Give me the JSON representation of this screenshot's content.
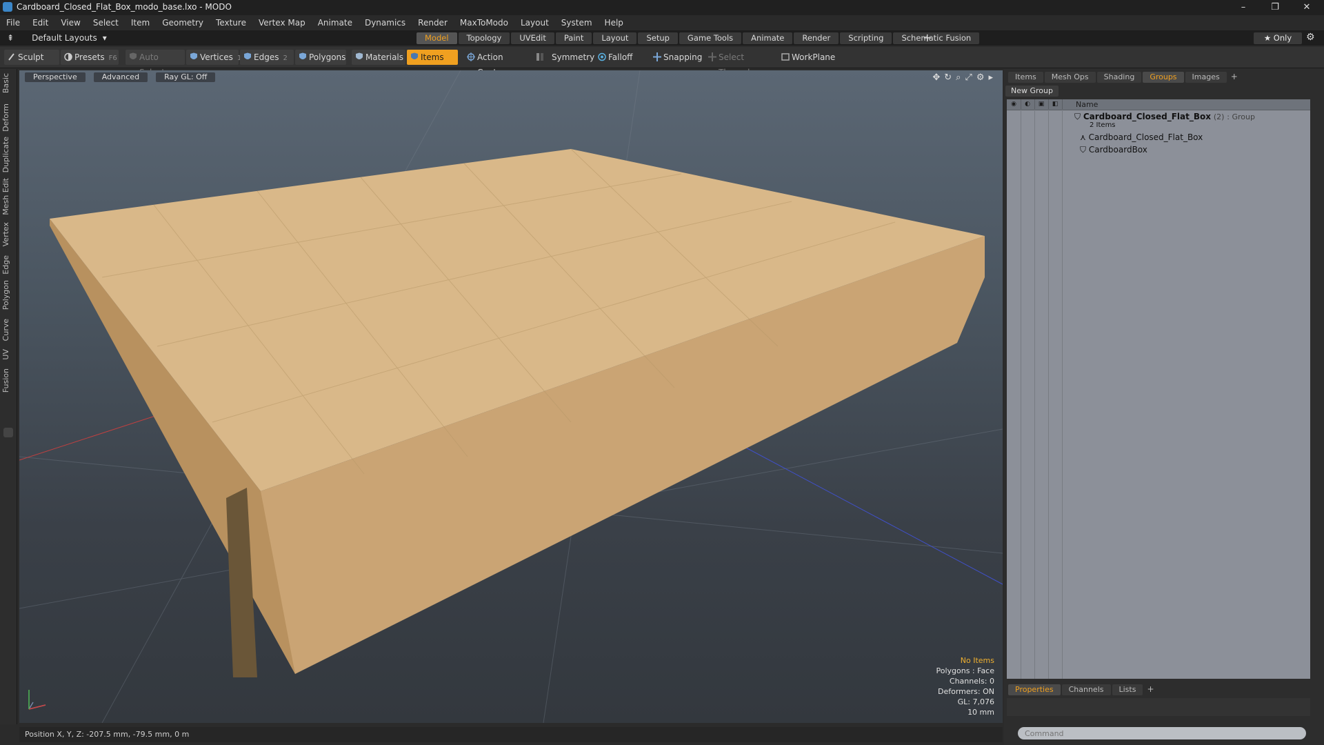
{
  "window": {
    "title": "Cardboard_Closed_Flat_Box_modo_base.lxo - MODO",
    "minimize": "–",
    "maximize": "❐",
    "close": "✕"
  },
  "menu": [
    "File",
    "Edit",
    "View",
    "Select",
    "Item",
    "Geometry",
    "Texture",
    "Vertex Map",
    "Animate",
    "Dynamics",
    "Render",
    "MaxToModo",
    "Layout",
    "System",
    "Help"
  ],
  "layout_bar": {
    "layouts_label": "Default Layouts",
    "tabs": [
      "Model",
      "Topology",
      "UVEdit",
      "Paint",
      "Layout",
      "Setup",
      "Game Tools",
      "Animate",
      "Render",
      "Scripting",
      "Schematic Fusion"
    ],
    "active_tab": "Model",
    "only_label": "★ Only"
  },
  "toolbar": {
    "sculpt": "Sculpt",
    "presets": "Presets",
    "presets_key": "F6",
    "auto_select": "Auto Select",
    "vertices": "Vertices",
    "vertices_num": "1",
    "edges": "Edges",
    "edges_num": "2",
    "polygons": "Polygons",
    "materials": "Materials",
    "items": "Items",
    "action_center": "Action Center",
    "symmetry": "Symmetry",
    "falloff": "Falloff",
    "snapping": "Snapping",
    "select_through": "Select Through",
    "workplane": "WorkPlane"
  },
  "left_tabs": [
    "Basic",
    "Deform",
    "Duplicate",
    "Mesh Edit",
    "Vertex",
    "Edge",
    "Polygon",
    "Curve",
    "UV",
    "Fusion"
  ],
  "viewport": {
    "view_mode": "Perspective",
    "shading": "Advanced",
    "raygl": "Ray GL: Off",
    "info": {
      "selection": "No Items",
      "polygons": "Polygons : Face",
      "channels": "Channels: 0",
      "deformers": "Deformers: ON",
      "gl": "GL: 7,076",
      "scale": "10 mm"
    }
  },
  "status": {
    "position": "Position X, Y, Z:  -207.5 mm, -79.5 mm, 0 m"
  },
  "right_panel": {
    "tabs": [
      "Items",
      "Mesh Ops",
      "Shading",
      "Groups",
      "Images"
    ],
    "active_tab": "Groups",
    "new_group": "New Group",
    "name_header": "Name",
    "group": {
      "name": "Cardboard_Closed_Flat_Box",
      "count": "(2)",
      "type": ": Group",
      "items_label": "2 Items"
    },
    "children": [
      "Cardboard_Closed_Flat_Box",
      "CardboardBox"
    ],
    "bottom_tabs": [
      "Properties",
      "Channels",
      "Lists"
    ],
    "bottom_active": "Properties",
    "command_placeholder": "Command"
  },
  "colors": {
    "accent": "#f0a020",
    "box": "#d8b384"
  }
}
